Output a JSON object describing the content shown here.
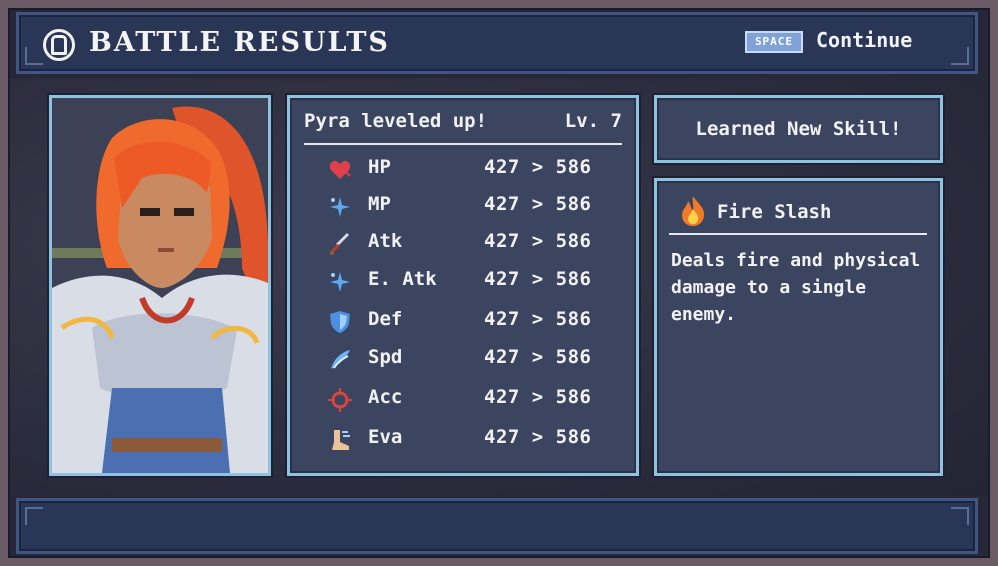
{
  "header": {
    "title": "BATTLE RESULTS",
    "key_label": "SPACE",
    "continue_label": "Continue"
  },
  "levelup": {
    "message": "Pyra leveled up!",
    "level": "Lv. 7"
  },
  "stats": [
    {
      "name": "HP",
      "value": "427 > 586",
      "icon": "heart-icon",
      "color": "#e0404a"
    },
    {
      "name": "MP",
      "value": "427 > 586",
      "icon": "sparkle-icon",
      "color": "#5fa8f0"
    },
    {
      "name": "Atk",
      "value": "427 > 586",
      "icon": "sword-icon",
      "color": "#c8a070"
    },
    {
      "name": "E. Atk",
      "value": "427 > 586",
      "icon": "sparkle-icon",
      "color": "#5fa8f0"
    },
    {
      "name": "Def",
      "value": "427 > 586",
      "icon": "shield-icon",
      "color": "#4f8fe0"
    },
    {
      "name": "Spd",
      "value": "427 > 586",
      "icon": "wing-icon",
      "color": "#6fb4f2"
    },
    {
      "name": "Acc",
      "value": "427 > 586",
      "icon": "crosshair-icon",
      "color": "#d9443c"
    },
    {
      "name": "Eva",
      "value": "427 > 586",
      "icon": "foot-icon",
      "color": "#e8c29a"
    }
  ],
  "learned": {
    "label": "Learned New Skill!"
  },
  "skill": {
    "name": "Fire Slash",
    "icon": "fire-icon",
    "description": "Deals fire and physical damage to a single enemy."
  },
  "colors": {
    "panel_border": "#8fc2de",
    "panel_bg": "#3b455f",
    "bar_bg": "#2a3656"
  }
}
